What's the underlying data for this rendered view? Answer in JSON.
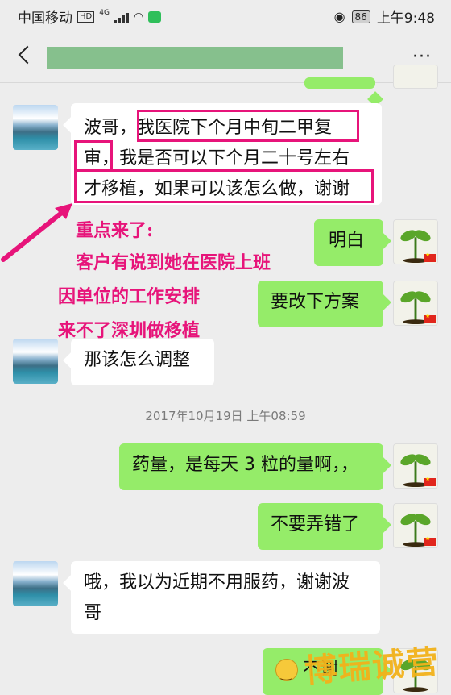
{
  "status_bar": {
    "carrier": "中国移动",
    "hd": "HD",
    "network": "4G",
    "battery": "86",
    "time": "上午9:48"
  },
  "header": {
    "back_icon": "chevron-left-icon",
    "more": "···"
  },
  "messages": [
    {
      "side": "left",
      "lines": [
        "波哥，我医院下个月中旬二甲复",
        "审，我是否可以下个月二十号左右",
        "才移植，如果可以该怎么做，谢谢"
      ]
    },
    {
      "side": "right",
      "text": "明白"
    },
    {
      "side": "right",
      "text": "要改下方案"
    },
    {
      "side": "left",
      "text": "那该怎么调整"
    },
    {
      "side": "right",
      "text": "药量，是每天 3 粒的量啊，，"
    },
    {
      "side": "right",
      "text": "不要弄错了"
    },
    {
      "side": "left",
      "lines": [
        "哦，我以为近期不用服药，谢谢波",
        "哥"
      ]
    },
    {
      "side": "right",
      "text": "不谢"
    }
  ],
  "timestamp": "2017年10月19日 上午08:59",
  "annotation": {
    "line1": "重点来了:",
    "line2": "客户有说到她在医院上班",
    "line3": "因单位的工作安排",
    "line4": "来不了深圳做移植",
    "color": "#e7147a"
  },
  "watermark": "博瑞诚营",
  "colors": {
    "bubble_right": "#95ec69",
    "bubble_left": "#ffffff",
    "background": "#ededed"
  }
}
